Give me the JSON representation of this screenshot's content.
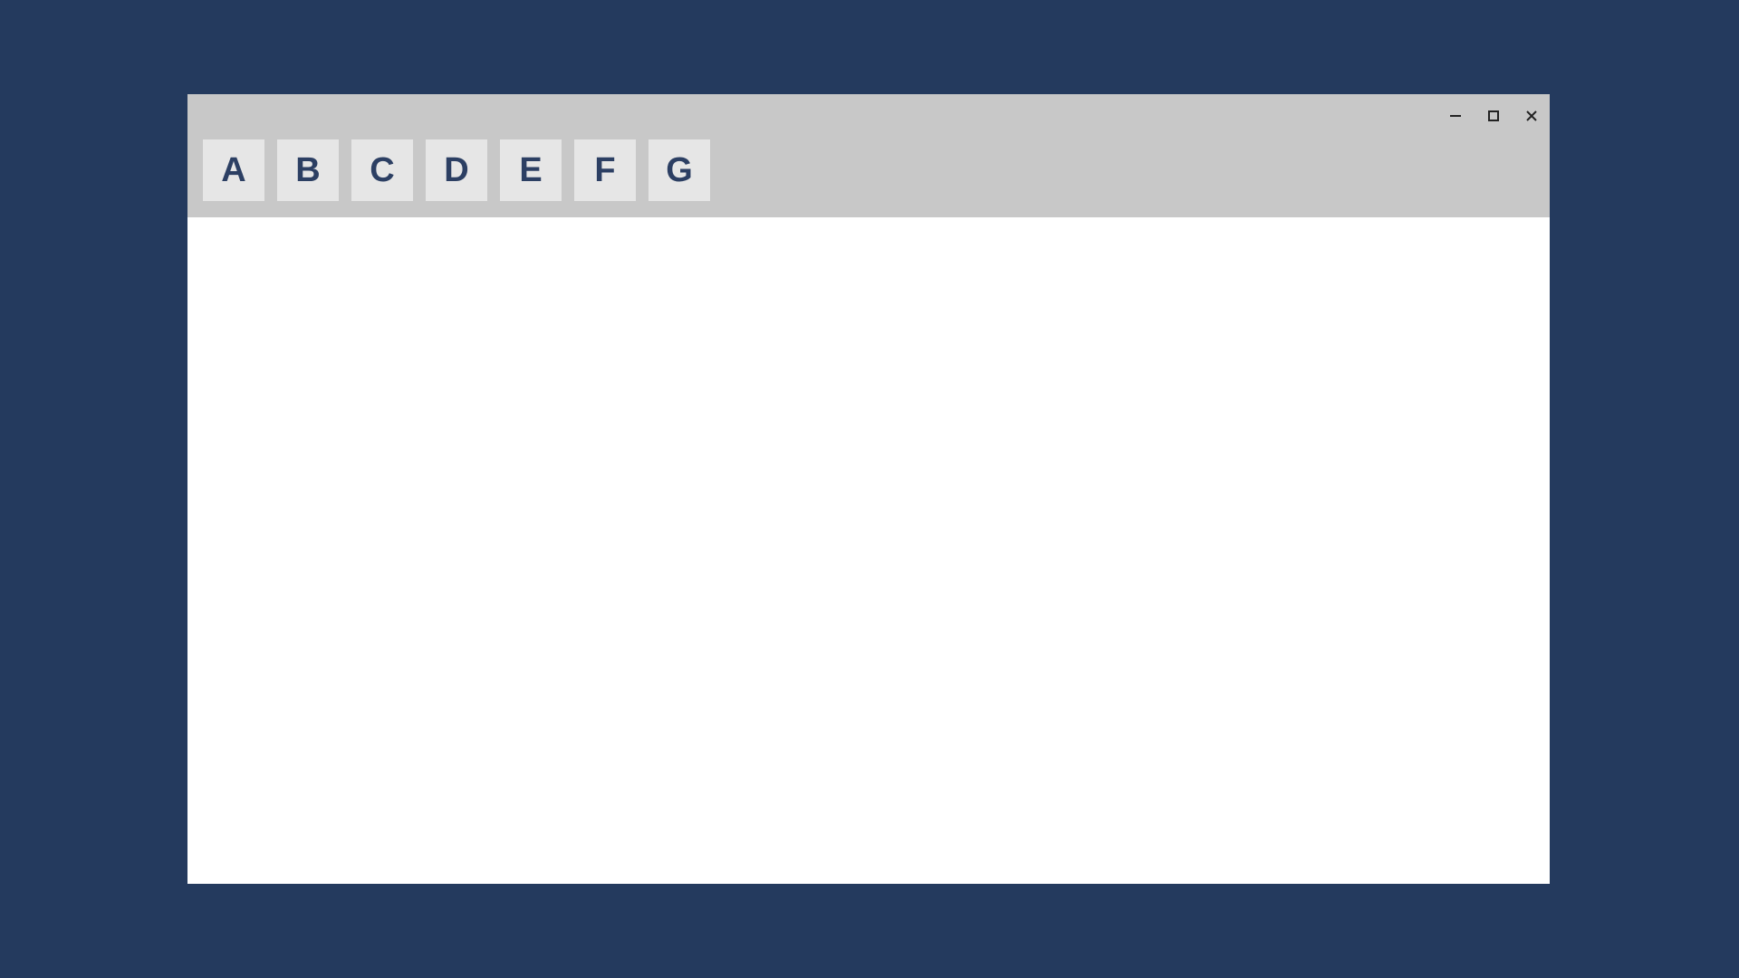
{
  "toolbar": {
    "buttons": [
      {
        "label": "A"
      },
      {
        "label": "B"
      },
      {
        "label": "C"
      },
      {
        "label": "D"
      },
      {
        "label": "E"
      },
      {
        "label": "F"
      },
      {
        "label": "G"
      }
    ]
  }
}
